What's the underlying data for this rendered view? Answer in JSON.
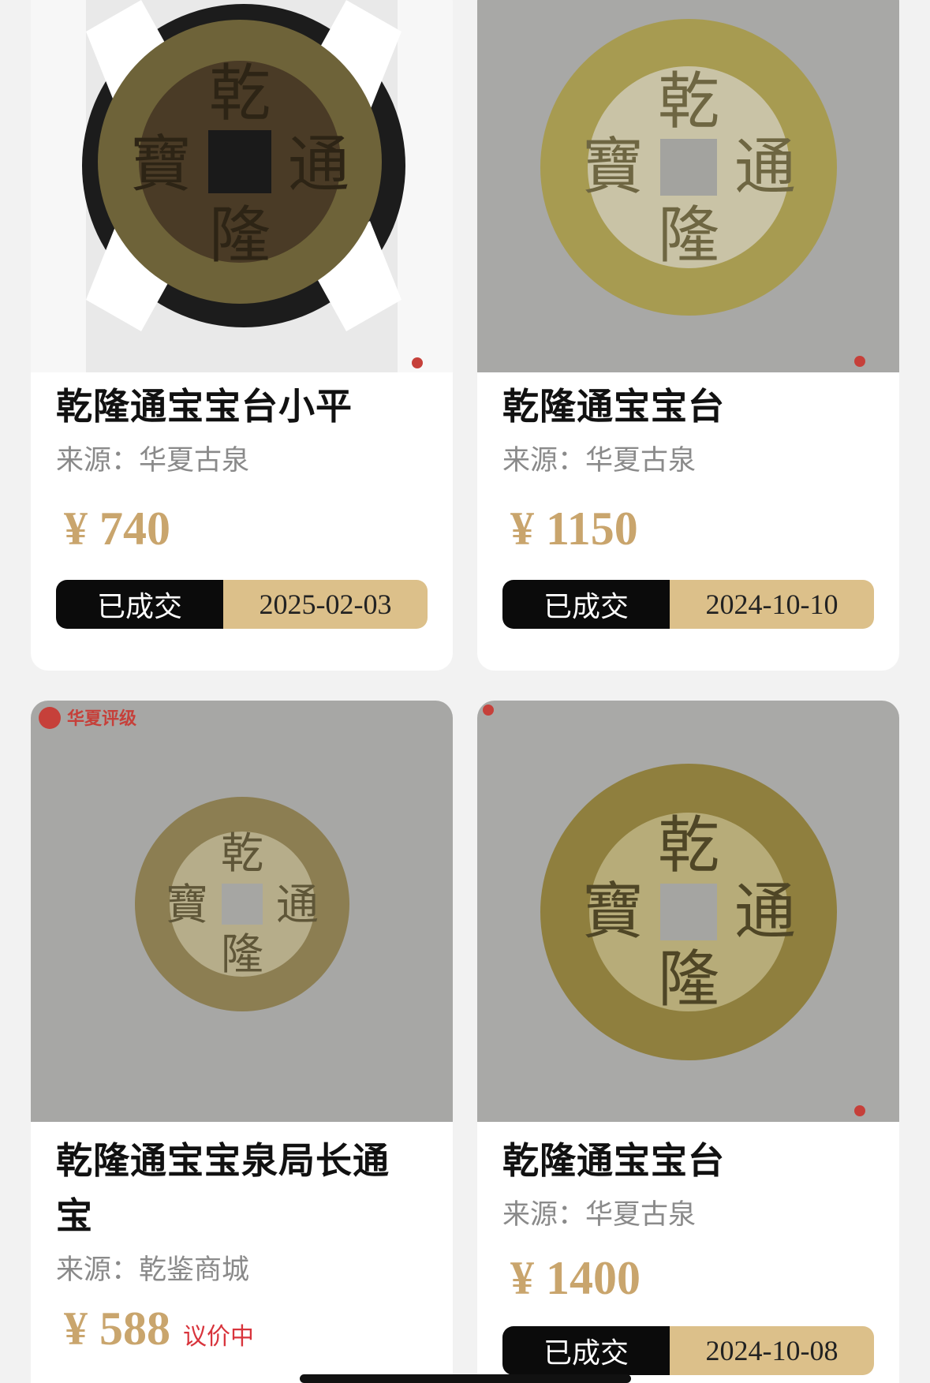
{
  "listings": [
    {
      "title": "乾隆通宝宝台小平",
      "source": "来源：华夏古泉",
      "price": "¥ 740",
      "status": "已成交",
      "date": "2025-02-03"
    },
    {
      "title": "乾隆通宝宝台",
      "source": "来源：华夏古泉",
      "price": "¥ 1150",
      "status": "已成交",
      "date": "2024-10-10"
    },
    {
      "title": "乾隆通宝宝泉局长通宝",
      "source": "来源：乾鉴商城",
      "price": "¥ 588",
      "status_tag": "议价中",
      "watermark": "华夏评级"
    },
    {
      "title": "乾隆通宝宝台",
      "source": "来源：华夏古泉",
      "price": "¥ 1400",
      "status": "已成交",
      "date": "2024-10-08"
    }
  ],
  "coin_inscription": [
    "乾",
    "隆",
    "通",
    "寶"
  ],
  "colors": {
    "price": "#c9a56d",
    "sold_bg": "#0b0b0b",
    "date_bg": "#dcc08a",
    "negotiating": "#d8343c"
  }
}
